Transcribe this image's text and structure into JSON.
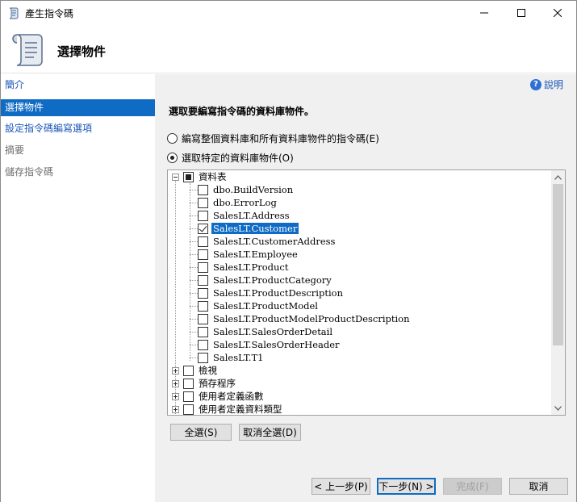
{
  "window": {
    "title": "產生指令碼"
  },
  "header": {
    "title": "選擇物件"
  },
  "sidebar": {
    "items": [
      {
        "label": "簡介",
        "state": "link"
      },
      {
        "label": "選擇物件",
        "state": "active"
      },
      {
        "label": "設定指令碼編寫選項",
        "state": "link"
      },
      {
        "label": "摘要",
        "state": "disabled"
      },
      {
        "label": "儲存指令碼",
        "state": "disabled"
      }
    ]
  },
  "main": {
    "help_label": "說明",
    "instruction": "選取要編寫指令碼的資料庫物件。",
    "radio_options": [
      {
        "label": "編寫整個資料庫和所有資料庫物件的指令碼(E)",
        "checked": false
      },
      {
        "label": "選取特定的資料庫物件(O)",
        "checked": true
      }
    ],
    "tree": {
      "tables_label": "資料表",
      "tables": [
        {
          "label": "dbo.BuildVersion",
          "checked": false
        },
        {
          "label": "dbo.ErrorLog",
          "checked": false
        },
        {
          "label": "SalesLT.Address",
          "checked": false
        },
        {
          "label": "SalesLT.Customer",
          "checked": true
        },
        {
          "label": "SalesLT.CustomerAddress",
          "checked": false
        },
        {
          "label": "SalesLT.Employee",
          "checked": false
        },
        {
          "label": "SalesLT.Product",
          "checked": false
        },
        {
          "label": "SalesLT.ProductCategory",
          "checked": false
        },
        {
          "label": "SalesLT.ProductDescription",
          "checked": false
        },
        {
          "label": "SalesLT.ProductModel",
          "checked": false
        },
        {
          "label": "SalesLT.ProductModelProductDescription",
          "checked": false
        },
        {
          "label": "SalesLT.SalesOrderDetail",
          "checked": false
        },
        {
          "label": "SalesLT.SalesOrderHeader",
          "checked": false
        },
        {
          "label": "SalesLT.T1",
          "checked": false
        }
      ],
      "other_groups": [
        {
          "label": "檢視"
        },
        {
          "label": "預存程序"
        },
        {
          "label": "使用者定義函數"
        },
        {
          "label": "使用者定義資料類型"
        }
      ]
    },
    "select_all_label": "全選(S)",
    "deselect_all_label": "取消全選(D)"
  },
  "footer": {
    "prev_label": "< 上一步(P)",
    "next_label": "下一步(N) >",
    "finish_label": "完成(F)",
    "cancel_label": "取消"
  },
  "colors": {
    "accent": "#0f6bc4",
    "link": "#1a56b8"
  }
}
